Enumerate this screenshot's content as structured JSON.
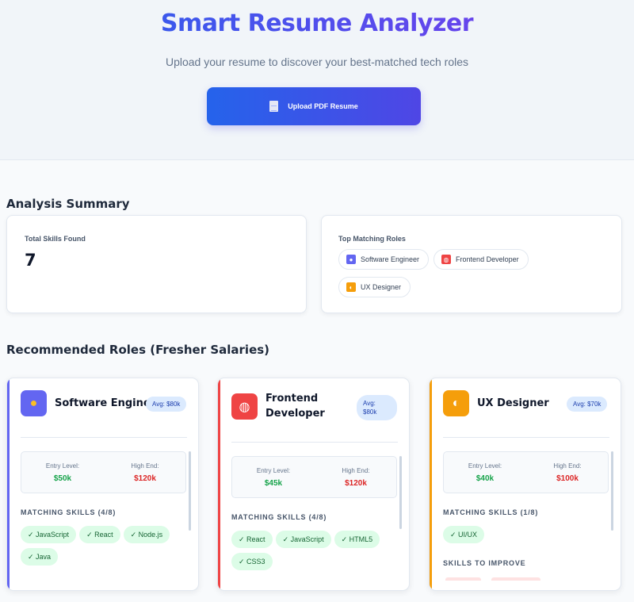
{
  "header": {
    "title": "Smart Resume Analyzer",
    "subtitle": "Upload your resume to discover your best-matched tech roles",
    "upload_label": "Upload PDF Resume"
  },
  "summary": {
    "section_title": "Analysis Summary",
    "total_skills_label": "Total Skills Found",
    "total_skills_value": "7",
    "top_roles_label": "Top Matching Roles",
    "top_roles": [
      "Software Engineer",
      "Frontend Developer",
      "UX Designer"
    ]
  },
  "roles_section_title": "Recommended Roles (Fresher Salaries)",
  "roles": [
    {
      "name": "Software Engineer",
      "avg": "Avg: $80k",
      "icon": "person-icon",
      "accent": "#6366f1",
      "entry_label": "Entry Level:",
      "entry_value": "$50k",
      "high_label": "High End:",
      "high_value": "$120k",
      "skills_label": "MATCHING SKILLS (4/8)",
      "skills": [
        "✓ JavaScript",
        "✓ React",
        "✓ Node.js",
        "✓ Java"
      ]
    },
    {
      "name": "Frontend Developer",
      "avg": "Avg: $80k",
      "icon": "globe-icon",
      "accent": "#ef4444",
      "entry_label": "Entry Level:",
      "entry_value": "$45k",
      "high_label": "High End:",
      "high_value": "$120k",
      "skills_label": "MATCHING SKILLS (4/8)",
      "skills": [
        "✓ React",
        "✓ JavaScript",
        "✓ HTML5",
        "✓ CSS3"
      ]
    },
    {
      "name": "UX Designer",
      "avg": "Avg: $70k",
      "icon": "palette-icon",
      "accent": "#f59e0b",
      "entry_label": "Entry Level:",
      "entry_value": "$40k",
      "high_label": "High End:",
      "high_value": "$100k",
      "skills_label": "MATCHING SKILLS (1/8)",
      "skills": [
        "✓ UI/UX"
      ],
      "improve_label": "SKILLS TO IMPROVE"
    }
  ]
}
